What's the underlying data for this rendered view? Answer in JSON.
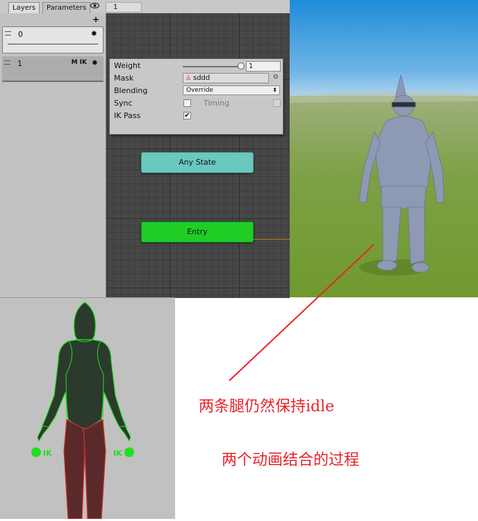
{
  "topbar": {
    "tabs": [
      {
        "label": "Layers"
      },
      {
        "label": "Parameters"
      }
    ],
    "eye_icon": "eye-icon",
    "breadcrumb": "1"
  },
  "layers": {
    "add_icon": "plus-icon",
    "items": [
      {
        "name": "0",
        "flags": "",
        "gear_icon": "gear-icon"
      },
      {
        "name": "1",
        "flags": "M IK",
        "gear_icon": "gear-icon"
      }
    ]
  },
  "layer_settings": {
    "weight_label": "Weight",
    "weight_value": "1",
    "weight_fraction": 1.0,
    "mask_label": "Mask",
    "mask_value": "sddd",
    "blending_label": "Blending",
    "blending_value": "Override",
    "sync_label": "Sync",
    "sync_checked": false,
    "timing_label": "Timing",
    "timing_checked": false,
    "ik_pass_label": "IK Pass",
    "ik_pass_checked": true
  },
  "graph": {
    "states": [
      {
        "label": "Any State"
      },
      {
        "label": "Entry"
      }
    ]
  },
  "avatar_mask": {
    "ik_left": "IK",
    "ik_right": "IK",
    "colors": {
      "enabled": "#1fe01f",
      "disabled": "#d9302b",
      "body_fill": "#2c3a2d",
      "leg_fill": "#5a2a2a"
    }
  },
  "annotations": {
    "line1": "两条腿仍然保持idle",
    "line2": "两个动画结合的过程",
    "color": "#e8232b"
  }
}
